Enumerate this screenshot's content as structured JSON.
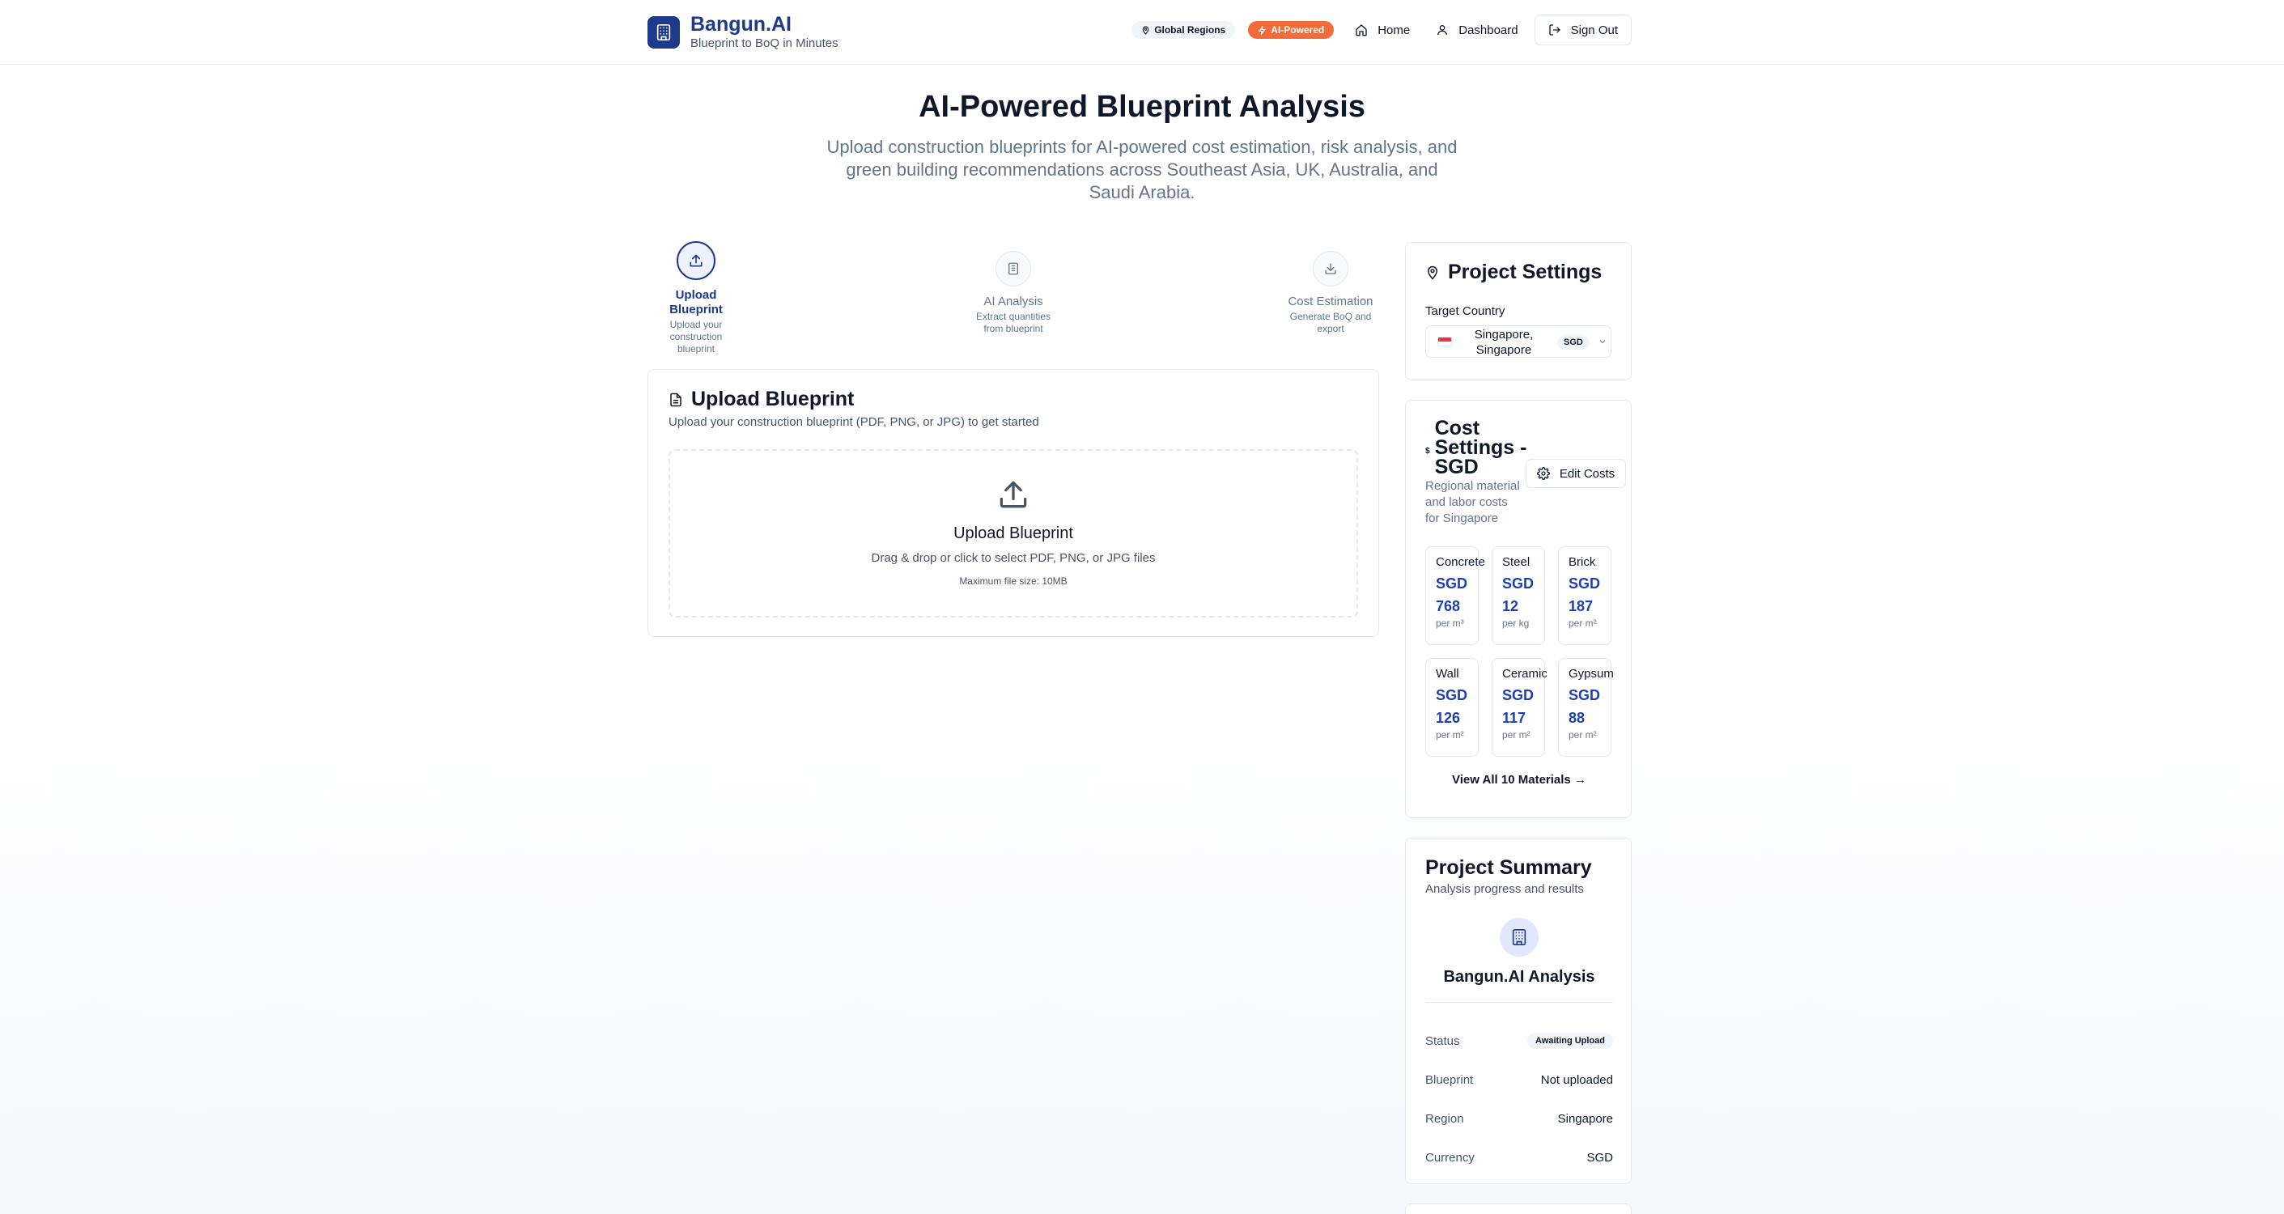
{
  "header": {
    "brand_name": "Bangun.AI",
    "brand_tagline": "Blueprint to BoQ in Minutes",
    "badge_regions": "Global Regions",
    "badge_ai": "AI-Powered",
    "nav_home": "Home",
    "nav_dashboard": "Dashboard",
    "sign_out": "Sign Out"
  },
  "hero": {
    "title": "AI-Powered Blueprint Analysis",
    "subtitle": "Upload construction blueprints for AI-powered cost estimation, risk analysis, and green building recommendations across Southeast Asia, UK, Australia, and Saudi Arabia."
  },
  "steps": [
    {
      "title": "Upload Blueprint",
      "desc": "Upload your construction blueprint",
      "icon": "upload-icon",
      "active": true
    },
    {
      "title": "AI Analysis",
      "desc": "Extract quantities from blueprint",
      "icon": "document-icon",
      "active": false
    },
    {
      "title": "Cost Estimation",
      "desc": "Generate BoQ and export",
      "icon": "download-icon",
      "active": false
    }
  ],
  "upload": {
    "title": "Upload Blueprint",
    "subtitle": "Upload your construction blueprint (PDF, PNG, or JPG) to get started",
    "drop_title": "Upload Blueprint",
    "drop_sub": "Drag & drop or click to select PDF, PNG, or JPG files",
    "drop_note": "Maximum file size: 10MB"
  },
  "project_settings": {
    "title": "Project Settings",
    "target_label": "Target Country",
    "country": "Singapore, Singapore",
    "currency_badge": "SGD"
  },
  "cost_settings": {
    "title": "Cost Settings - SGD",
    "icon_glyph": "$",
    "subtitle": "Regional material and labor costs for Singapore",
    "edit_label": "Edit Costs",
    "materials": [
      {
        "name": "Concrete",
        "price": "SGD 768",
        "unit": "per m³"
      },
      {
        "name": "Steel",
        "price": "SGD 12",
        "unit": "per kg"
      },
      {
        "name": "Brick",
        "price": "SGD 187",
        "unit": "per m²"
      },
      {
        "name": "Wall",
        "price": "SGD 126",
        "unit": "per m²"
      },
      {
        "name": "Ceramic",
        "price": "SGD 117",
        "unit": "per m²"
      },
      {
        "name": "Gypsum",
        "price": "SGD 88",
        "unit": "per m²"
      }
    ],
    "view_all": "View All 10 Materials →"
  },
  "summary": {
    "title": "Project Summary",
    "subtitle": "Analysis progress and results",
    "name": "Bangun.AI Analysis",
    "rows": [
      {
        "key": "Status",
        "value": "Awaiting Upload"
      },
      {
        "key": "Blueprint",
        "value": "Not uploaded"
      },
      {
        "key": "Region",
        "value": "Singapore"
      },
      {
        "key": "Currency",
        "value": "SGD"
      }
    ]
  },
  "colors": {
    "brand": "#1e3a8a",
    "accent_orange": "#f26b3a",
    "price_blue": "#1e40af"
  }
}
